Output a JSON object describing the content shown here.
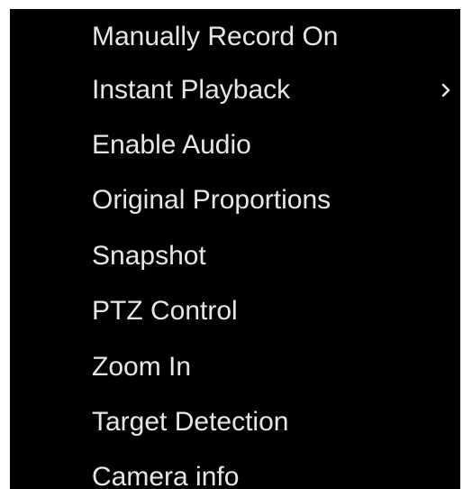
{
  "menu": {
    "items": [
      {
        "label": "Manually Record On",
        "has_submenu": false
      },
      {
        "label": "Instant Playback",
        "has_submenu": true
      },
      {
        "label": "Enable Audio",
        "has_submenu": false
      },
      {
        "label": "Original Proportions",
        "has_submenu": false
      },
      {
        "label": "Snapshot",
        "has_submenu": false
      },
      {
        "label": "PTZ Control",
        "has_submenu": false
      },
      {
        "label": "Zoom In",
        "has_submenu": false
      },
      {
        "label": "Target Detection",
        "has_submenu": false
      },
      {
        "label": "Camera info",
        "has_submenu": false
      }
    ],
    "submenu_icon": "chevron-right-icon"
  },
  "colors": {
    "background": "#000000",
    "text": "#e6e6e6",
    "page": "#ffffff"
  }
}
